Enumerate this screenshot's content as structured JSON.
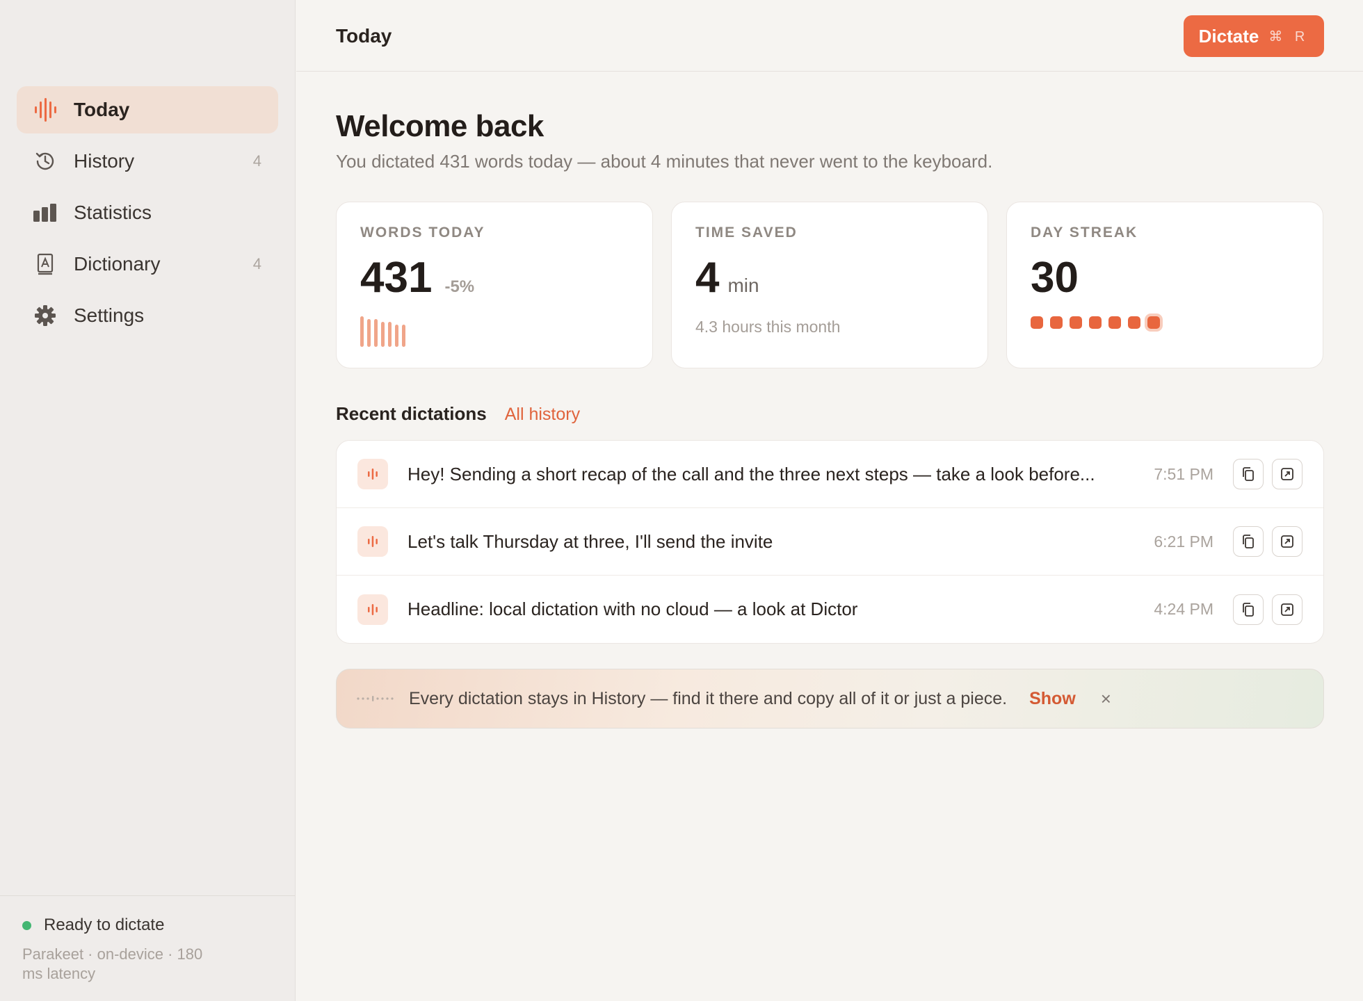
{
  "sidebar": {
    "items": [
      {
        "label": "Today",
        "count": "",
        "icon": "waveform-icon"
      },
      {
        "label": "History",
        "count": "4",
        "icon": "history-icon"
      },
      {
        "label": "Statistics",
        "count": "",
        "icon": "bar-chart-icon"
      },
      {
        "label": "Dictionary",
        "count": "4",
        "icon": "dictionary-icon"
      },
      {
        "label": "Settings",
        "count": "",
        "icon": "gear-icon"
      }
    ],
    "status": {
      "text": "Ready to dictate",
      "color": "#43b672"
    },
    "engine": "Parakeet · on-device · 180 ms latency"
  },
  "header": {
    "title": "Today",
    "dictate": {
      "label": "Dictate",
      "shortcut": "⌘ R"
    }
  },
  "main": {
    "welcome": "Welcome back",
    "subtitle": "You dictated 431 words today — about 4 minutes that never went to the keyboard.",
    "cards": {
      "words": {
        "label": "WORDS TODAY",
        "value": "431",
        "delta": "-5%"
      },
      "time": {
        "label": "TIME SAVED",
        "value": "4",
        "unit": "min",
        "note": "4.3 hours this month"
      },
      "streak": {
        "label": "DAY STREAK",
        "value": "30"
      }
    },
    "recent": {
      "title": "Recent dictations",
      "link": "All history",
      "items": [
        {
          "text": "Hey! Sending a short recap of the call and the three next steps — take a look before...",
          "time": "7:51 PM"
        },
        {
          "text": "Let's talk Thursday at three, I'll send the invite",
          "time": "6:21 PM"
        },
        {
          "text": "Headline: local dictation with no cloud — a look at Dictor",
          "time": "4:24 PM"
        }
      ]
    },
    "tip": {
      "text": "Every dictation stays in History — find it there and copy all of it or just a piece.",
      "action": "Show",
      "close": "×"
    }
  },
  "colors": {
    "accent": "#ec6a43",
    "active_nav": "#f1dfd4",
    "background": "#f6f4f1"
  }
}
